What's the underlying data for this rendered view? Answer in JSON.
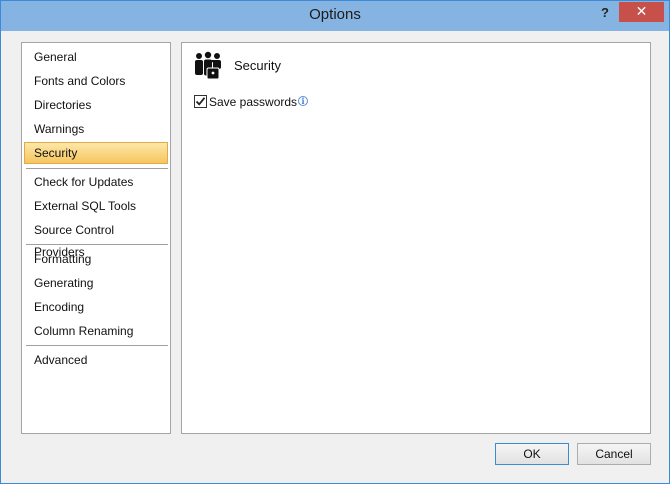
{
  "window": {
    "title": "Options",
    "help_label": "?",
    "close_label": "✕"
  },
  "nav": {
    "items": [
      "General",
      "Fonts and Colors",
      "Directories",
      "Warnings",
      "Security",
      "Check for Updates",
      "External SQL Tools",
      "Source Control Providers",
      "Formatting",
      "Generating",
      "Encoding",
      "Column Renaming",
      "Advanced"
    ],
    "selected": "Security"
  },
  "content": {
    "section_title": "Security",
    "section_icon": "users-lock-icon",
    "save_passwords": {
      "label": "Save passwords",
      "checked": true
    },
    "info_icon": "info-icon"
  },
  "buttons": {
    "ok": "OK",
    "cancel": "Cancel"
  },
  "colors": {
    "titlebar": "#86b4e2",
    "selection": "#f6c65f",
    "close": "#c7504a"
  }
}
